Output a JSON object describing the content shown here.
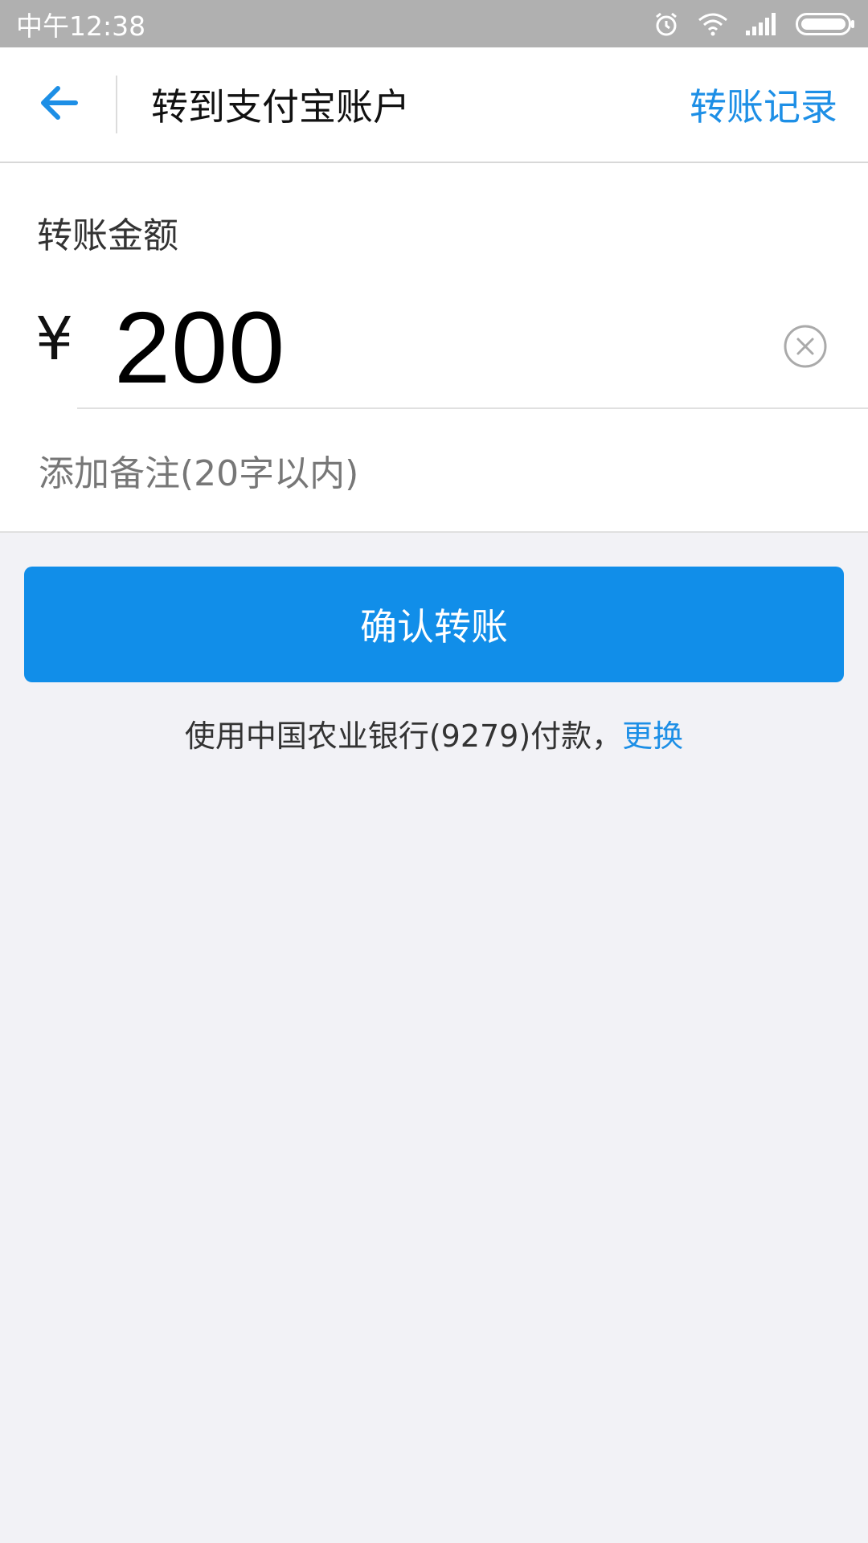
{
  "status_bar": {
    "time": "中午12:38",
    "icons": [
      "alarm-icon",
      "wifi-icon",
      "signal-icon",
      "battery-icon"
    ]
  },
  "nav": {
    "title": "转到支付宝账户",
    "right_link": "转账记录",
    "back_icon": "arrow-left-icon"
  },
  "form": {
    "amount_label": "转账金额",
    "currency_symbol": "¥",
    "amount_value": "200",
    "remark_placeholder": "添加备注(20字以内)"
  },
  "actions": {
    "confirm_label": "确认转账",
    "pay_info_text": "使用中国农业银行(9279)付款，",
    "change_link": "更换"
  },
  "colors": {
    "accent": "#118ee9",
    "link": "#1d8fe6",
    "page_bg": "#f2f2f6"
  }
}
